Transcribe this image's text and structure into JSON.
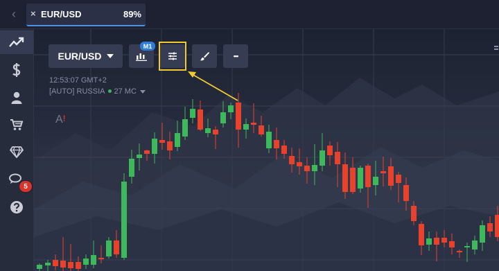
{
  "tab": {
    "close": "×",
    "name": "EUR/USD",
    "payout": "89%"
  },
  "nav": {
    "back": "‹"
  },
  "sidebar": {
    "chat_badge": "5"
  },
  "toolbar": {
    "pair": "EUR/USD",
    "timeframe_badge": "M1",
    "more": "•••",
    "indicators_highlighted": true
  },
  "info": {
    "time": "12:53:07 GMT+2",
    "server": "[AUTO] RUSSIA",
    "ping": "27 MC"
  },
  "chart_area": {
    "alert_label": "A"
  },
  "colors": {
    "up": "#3db85a",
    "down": "#e8412c",
    "accent": "#2f7cd4",
    "highlight": "#f1c931"
  }
}
